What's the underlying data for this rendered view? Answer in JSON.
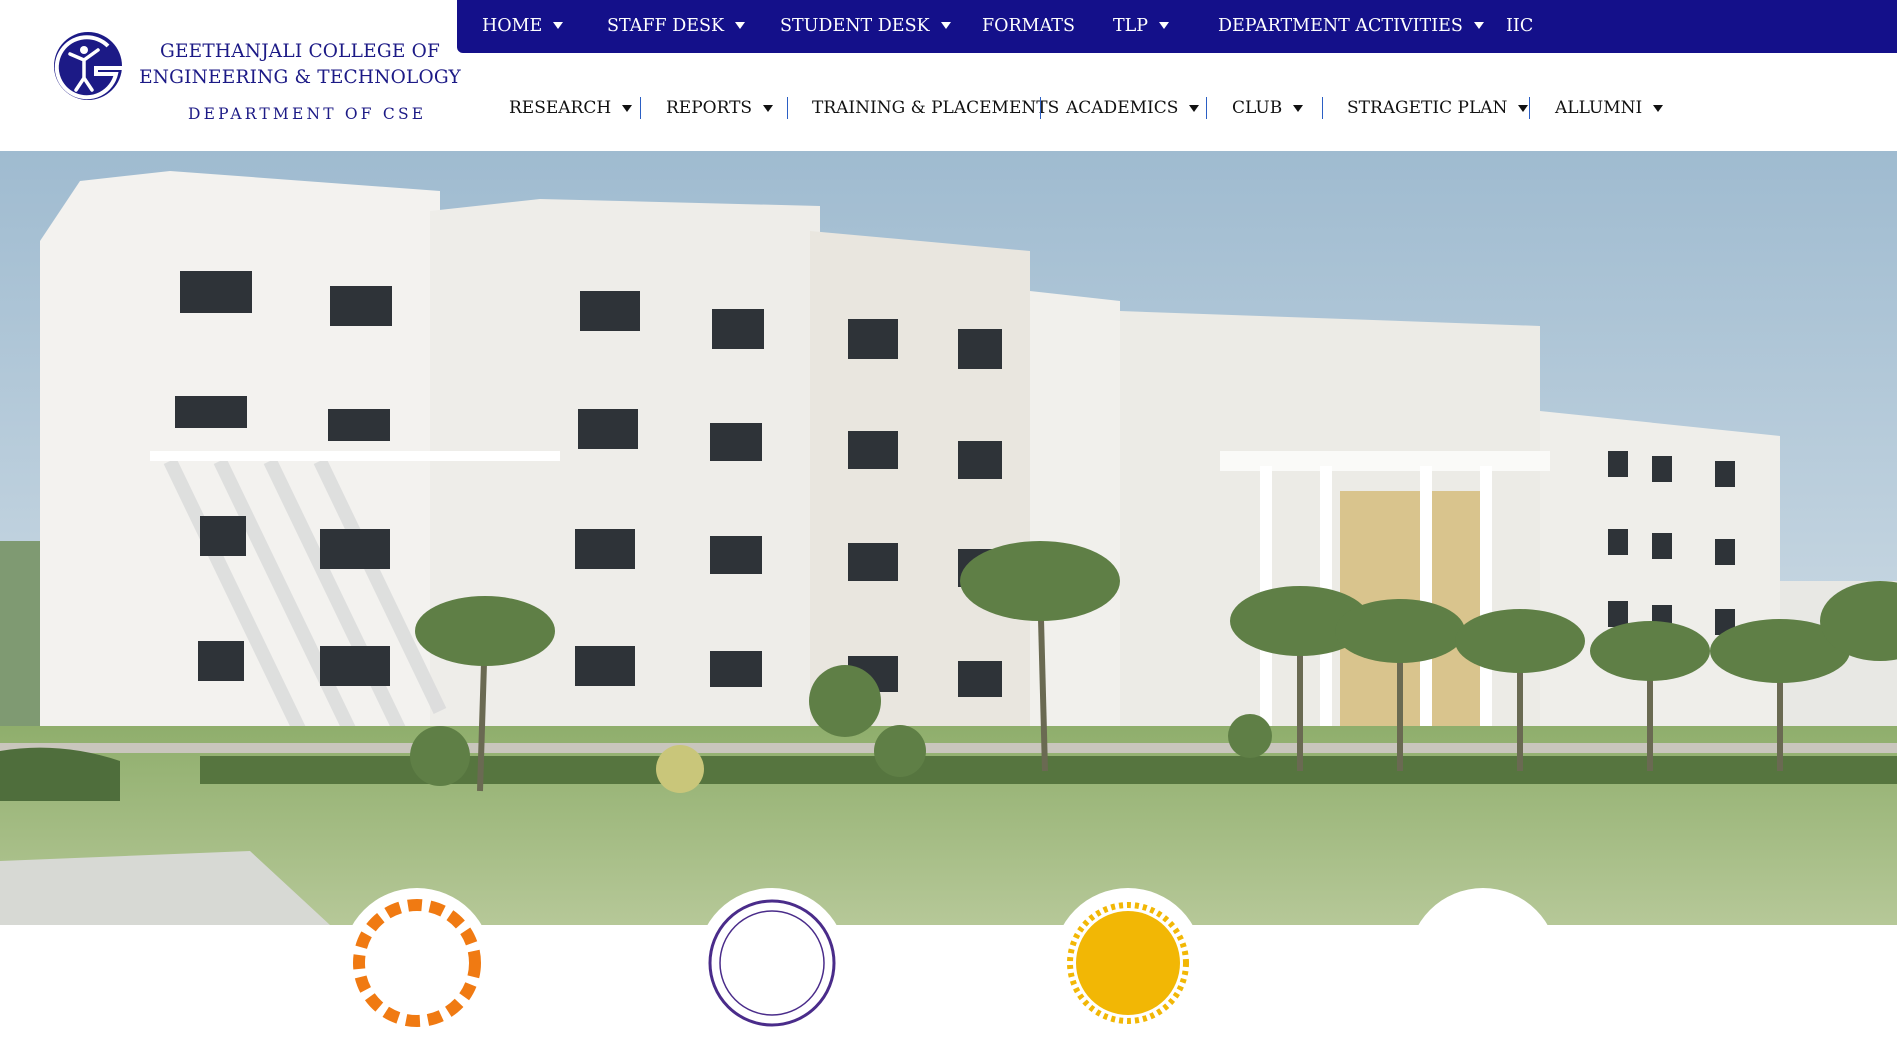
{
  "logo": {
    "line1": "GEETHANJALI COLLEGE OF",
    "line2": "ENGINEERING & TECHNOLOGY",
    "department": "DEPARTMENT OF CSE",
    "mark_letter": "G",
    "brand_color": "#1c1a86"
  },
  "top_nav": {
    "background": "#14108a",
    "items": [
      {
        "label": "HOME",
        "dropdown": true
      },
      {
        "label": "STAFF DESK",
        "dropdown": true
      },
      {
        "label": "STUDENT DESK",
        "dropdown": true
      },
      {
        "label": "FORMATS",
        "dropdown": false
      },
      {
        "label": "TLP",
        "dropdown": true
      },
      {
        "label": "DEPARTMENT ACTIVITIES",
        "dropdown": true
      },
      {
        "label": "IIC",
        "dropdown": false
      }
    ]
  },
  "sub_nav": {
    "separator_color": "#2b5fc4",
    "items": [
      {
        "label": "RESEARCH",
        "dropdown": true
      },
      {
        "label": "REPORTS",
        "dropdown": true
      },
      {
        "label": "TRAINING & PLACEMENTS",
        "dropdown": false
      },
      {
        "label": "ACADEMICS",
        "dropdown": true
      },
      {
        "label": "CLUB",
        "dropdown": true
      },
      {
        "label": "STRAGETIC PLAN",
        "dropdown": true
      },
      {
        "label": "ALLUMNI",
        "dropdown": true
      }
    ]
  },
  "hero": {
    "image": "campus-building-photo",
    "sky_color": "#a9c3d6",
    "lawn_color": "#9fb97d"
  },
  "badges": [
    {
      "icon": "gear-logo-icon",
      "accent": "#f07a12"
    },
    {
      "icon": "technology-seal-icon",
      "accent": "#4a2c8a"
    },
    {
      "icon": "gold-seal-icon",
      "accent": "#f2b705"
    },
    {
      "icon": "blank-badge-icon",
      "accent": "#ffffff"
    }
  ]
}
